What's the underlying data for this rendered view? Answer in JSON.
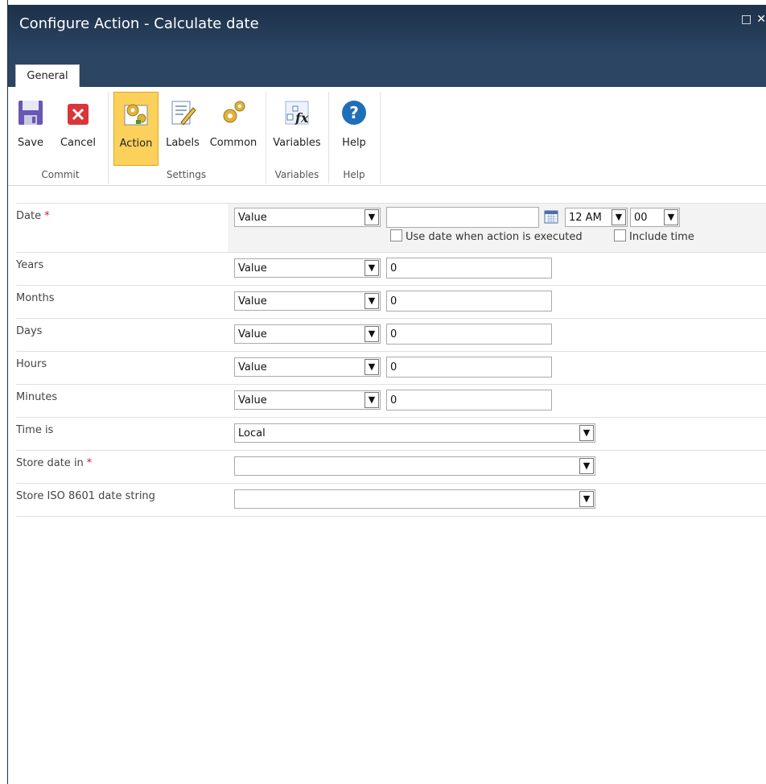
{
  "window": {
    "title": "Configure Action - Calculate date"
  },
  "ribbon": {
    "tab_general": "General",
    "buttons": {
      "save": "Save",
      "cancel": "Cancel",
      "action": "Action",
      "labels": "Labels",
      "common": "Common",
      "variables": "Variables",
      "help": "Help"
    },
    "groups": {
      "commit": "Commit",
      "settings": "Settings",
      "variables": "Variables",
      "help": "Help"
    }
  },
  "form": {
    "date": {
      "label": "Date",
      "required_mark": "*",
      "type": "Value",
      "value": "",
      "hour": "12 AM",
      "minute": "00",
      "use_exec_label": "Use date when action is executed",
      "include_time_label": "Include time"
    },
    "years": {
      "label": "Years",
      "type": "Value",
      "value": "0"
    },
    "months": {
      "label": "Months",
      "type": "Value",
      "value": "0"
    },
    "days": {
      "label": "Days",
      "type": "Value",
      "value": "0"
    },
    "hours": {
      "label": "Hours",
      "type": "Value",
      "value": "0"
    },
    "minutes": {
      "label": "Minutes",
      "type": "Value",
      "value": "0"
    },
    "time_is": {
      "label": "Time is",
      "value": "Local"
    },
    "store_date": {
      "label": "Store date in",
      "required_mark": "*",
      "value": ""
    },
    "store_iso": {
      "label": "Store ISO 8601 date string",
      "value": ""
    }
  },
  "colors": {
    "titlebar": "#2b4563",
    "active_button": "#fbd15b",
    "required": "#d61b1b"
  }
}
